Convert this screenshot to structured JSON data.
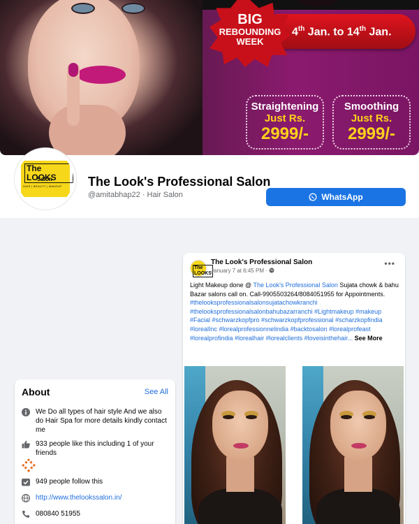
{
  "cover": {
    "burst_line1": "BIG",
    "burst_line2": "REBOUNDING",
    "burst_line3": "WEEK",
    "dates_prefix": "4",
    "dates_sup1": "th",
    "dates_mid": " Jan. to 14",
    "dates_sup2": "th",
    "dates_suffix": " Jan.",
    "offer1": {
      "service": "Straightening",
      "label": "Just Rs.",
      "price": "2999/-"
    },
    "offer2": {
      "service": "Smoothing",
      "label": "Just Rs.",
      "price": "2999/-"
    }
  },
  "logo": {
    "name": "The LOOKS",
    "sub": "Salon",
    "tagline": "HAIR | BEAUTY | MAKEUP"
  },
  "page": {
    "name": "The Look's Professional Salon",
    "handle": "@amitabhap22 · Hair Salon",
    "whatsapp_label": "WhatsApp"
  },
  "about": {
    "title": "About",
    "see_all": "See All",
    "description": "We Do all types of hair style And we also do Hair Spa for more details kindly contact me",
    "likes": "933 people like this including 1 of your friends",
    "follows": "949 people follow this",
    "website": "http://www.thelookssalon.in/",
    "phone": "080840 51955"
  },
  "post": {
    "author": "The Look's Professional Salon",
    "time": "January 7 at 6:45 PM · ",
    "menu": "•••",
    "text_pre": "Light Makeup done @ ",
    "text_link": "The Look's Professional Salon",
    "text_post": "  Sujata chowk & bahu Bazar salons call on. Call-9905503264/8084051955 for Appointments.",
    "hashtags": "#thelooksprofessionalsalonsujatachowkranchi #thelooksprofessionalsalonbahubazarranchi #Lightmakeup #makeup #Facial #schwarzkopfpro #schwarzkopfprofessional #scharzkopfindia #lorealInc #lorealprofessionnelindia #backtosalon #lorealprofeast #lorealprofindia #lorealhair #lorealclients #loveisinthehair...",
    "see_more": "See More"
  },
  "colors": {
    "accent": "#1b74e4",
    "link": "#216fdb",
    "page_bg": "#f0f2f5"
  }
}
